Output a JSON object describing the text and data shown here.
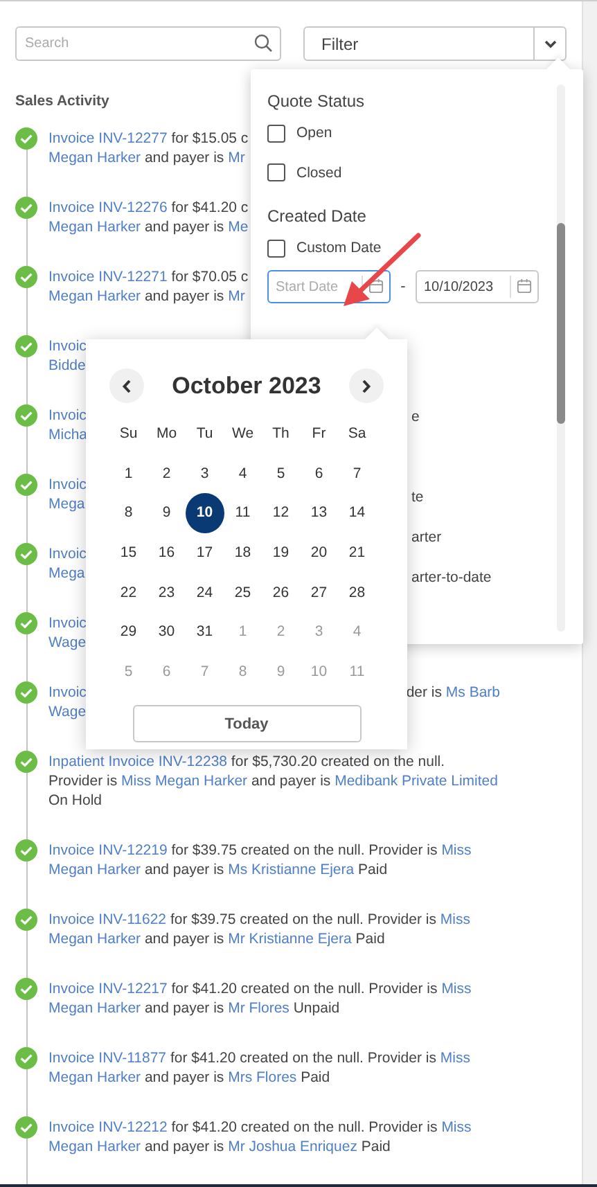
{
  "search": {
    "placeholder": "Search"
  },
  "filter": {
    "label": "Filter"
  },
  "sales_activity": {
    "title": "Sales Activity",
    "items": [
      {
        "lines": [
          [
            {
              "t": "Invoice INV-12277",
              "link": true
            },
            {
              "t": " for $15.05 c",
              "link": false
            }
          ],
          [
            {
              "t": "Megan Harker",
              "link": true
            },
            {
              "t": " and payer is ",
              "link": false
            },
            {
              "t": "Mr",
              "link": true
            }
          ]
        ]
      },
      {
        "lines": [
          [
            {
              "t": "Invoice INV-12276",
              "link": true
            },
            {
              "t": " for $41.20 c",
              "link": false
            }
          ],
          [
            {
              "t": "Megan Harker",
              "link": true
            },
            {
              "t": " and payer is ",
              "link": false
            },
            {
              "t": "Me",
              "link": true
            }
          ]
        ]
      },
      {
        "lines": [
          [
            {
              "t": "Invoice INV-12271",
              "link": true
            },
            {
              "t": " for $70.05 c",
              "link": false
            }
          ],
          [
            {
              "t": "Megan Harker",
              "link": true
            },
            {
              "t": " and payer is ",
              "link": false
            },
            {
              "t": "Mr",
              "link": true
            }
          ]
        ]
      },
      {
        "lines": [
          [
            {
              "t": "Invoic",
              "link": true
            }
          ],
          [
            {
              "t": "Bidde",
              "link": true
            }
          ]
        ]
      },
      {
        "lines": [
          [
            {
              "t": "Invoic",
              "link": true
            }
          ],
          [
            {
              "t": "Micha",
              "link": true
            }
          ]
        ]
      },
      {
        "lines": [
          [
            {
              "t": "Invoic",
              "link": true
            }
          ],
          [
            {
              "t": "Mega",
              "link": true
            }
          ]
        ]
      },
      {
        "lines": [
          [
            {
              "t": "Invoic",
              "link": true
            }
          ],
          [
            {
              "t": "Mega",
              "link": true
            }
          ]
        ]
      },
      {
        "lines": [
          [
            {
              "t": "Invoic",
              "link": true
            }
          ],
          [
            {
              "t": "Wage",
              "link": true
            }
          ]
        ]
      },
      {
        "lines": [
          [
            {
              "t": "Invoic",
              "link": true
            }
          ],
          [
            {
              "t": "Wage",
              "link": true
            }
          ]
        ],
        "aside": [
          {
            "t": "der is ",
            "link": false
          },
          {
            "t": "Ms Barb",
            "link": true
          }
        ]
      },
      {
        "lines": [
          [
            {
              "t": "Inpatient Invoice INV-12238",
              "link": true
            },
            {
              "t": " for $5,730.20 created on the null.",
              "link": false
            }
          ],
          [
            {
              "t": "Provider is ",
              "link": false
            },
            {
              "t": "Miss Megan Harker",
              "link": true
            },
            {
              "t": " and payer is ",
              "link": false
            },
            {
              "t": "Medibank Private Limited",
              "link": true
            }
          ],
          [
            {
              "t": "On Hold",
              "link": false
            }
          ]
        ]
      },
      {
        "lines": [
          [
            {
              "t": "Invoice INV-12219",
              "link": true
            },
            {
              "t": " for $39.75 created on the null. Provider is ",
              "link": false
            },
            {
              "t": "Miss",
              "link": true
            }
          ],
          [
            {
              "t": "Megan Harker",
              "link": true
            },
            {
              "t": " and payer is ",
              "link": false
            },
            {
              "t": "Ms Kristianne Ejera",
              "link": true
            },
            {
              "t": " Paid",
              "link": false
            }
          ]
        ]
      },
      {
        "lines": [
          [
            {
              "t": "Invoice INV-11622",
              "link": true
            },
            {
              "t": " for $39.75 created on the null. Provider is ",
              "link": false
            },
            {
              "t": "Miss",
              "link": true
            }
          ],
          [
            {
              "t": "Megan Harker",
              "link": true
            },
            {
              "t": " and payer is ",
              "link": false
            },
            {
              "t": "Mr Kristianne Ejera",
              "link": true
            },
            {
              "t": " Paid",
              "link": false
            }
          ]
        ]
      },
      {
        "lines": [
          [
            {
              "t": "Invoice INV-12217",
              "link": true
            },
            {
              "t": " for $41.20 created on the null. Provider is ",
              "link": false
            },
            {
              "t": "Miss",
              "link": true
            }
          ],
          [
            {
              "t": "Megan Harker",
              "link": true
            },
            {
              "t": " and payer is ",
              "link": false
            },
            {
              "t": "Mr Flores",
              "link": true
            },
            {
              "t": " Unpaid",
              "link": false
            }
          ]
        ]
      },
      {
        "lines": [
          [
            {
              "t": "Invoice INV-11877",
              "link": true
            },
            {
              "t": " for $41.20 created on the null. Provider is ",
              "link": false
            },
            {
              "t": "Miss",
              "link": true
            }
          ],
          [
            {
              "t": "Megan Harker",
              "link": true
            },
            {
              "t": " and payer is ",
              "link": false
            },
            {
              "t": "Mrs Flores",
              "link": true
            },
            {
              "t": " Paid",
              "link": false
            }
          ]
        ]
      },
      {
        "lines": [
          [
            {
              "t": "Invoice INV-12212",
              "link": true
            },
            {
              "t": " for $41.20 created on the null. Provider is ",
              "link": false
            },
            {
              "t": "Miss",
              "link": true
            }
          ],
          [
            {
              "t": "Megan Harker",
              "link": true
            },
            {
              "t": " and payer is ",
              "link": false
            },
            {
              "t": "Mr Joshua Enriquez",
              "link": true
            },
            {
              "t": " Paid",
              "link": false
            }
          ]
        ]
      }
    ]
  },
  "filter_panel": {
    "sections": [
      {
        "title": "Quote Status",
        "options": [
          {
            "label": "Open",
            "checked": false
          },
          {
            "label": "Closed",
            "checked": false
          }
        ]
      },
      {
        "title": "Created Date",
        "options": [
          {
            "label": "Custom Date",
            "checked": false
          }
        ]
      }
    ],
    "start_date": {
      "placeholder": "Start Date",
      "focused": true
    },
    "separator": "-",
    "end_date": {
      "value": "10/10/2023",
      "focused": false
    },
    "covered_options": [
      "e",
      "te",
      "arter",
      "arter-to-date"
    ]
  },
  "calendar": {
    "month": "October 2023",
    "weekdays": [
      "Su",
      "Mo",
      "Tu",
      "We",
      "Th",
      "Fr",
      "Sa"
    ],
    "weeks": [
      [
        {
          "d": "1",
          "muted": false,
          "selected": false
        },
        {
          "d": "2",
          "muted": false,
          "selected": false
        },
        {
          "d": "3",
          "muted": false,
          "selected": false
        },
        {
          "d": "4",
          "muted": false,
          "selected": false
        },
        {
          "d": "5",
          "muted": false,
          "selected": false
        },
        {
          "d": "6",
          "muted": false,
          "selected": false
        },
        {
          "d": "7",
          "muted": false,
          "selected": false
        }
      ],
      [
        {
          "d": "8",
          "muted": false,
          "selected": false
        },
        {
          "d": "9",
          "muted": false,
          "selected": false
        },
        {
          "d": "10",
          "muted": false,
          "selected": true
        },
        {
          "d": "11",
          "muted": false,
          "selected": false
        },
        {
          "d": "12",
          "muted": false,
          "selected": false
        },
        {
          "d": "13",
          "muted": false,
          "selected": false
        },
        {
          "d": "14",
          "muted": false,
          "selected": false
        }
      ],
      [
        {
          "d": "15",
          "muted": false,
          "selected": false
        },
        {
          "d": "16",
          "muted": false,
          "selected": false
        },
        {
          "d": "17",
          "muted": false,
          "selected": false
        },
        {
          "d": "18",
          "muted": false,
          "selected": false
        },
        {
          "d": "19",
          "muted": false,
          "selected": false
        },
        {
          "d": "20",
          "muted": false,
          "selected": false
        },
        {
          "d": "21",
          "muted": false,
          "selected": false
        }
      ],
      [
        {
          "d": "22",
          "muted": false,
          "selected": false
        },
        {
          "d": "23",
          "muted": false,
          "selected": false
        },
        {
          "d": "24",
          "muted": false,
          "selected": false
        },
        {
          "d": "25",
          "muted": false,
          "selected": false
        },
        {
          "d": "26",
          "muted": false,
          "selected": false
        },
        {
          "d": "27",
          "muted": false,
          "selected": false
        },
        {
          "d": "28",
          "muted": false,
          "selected": false
        }
      ],
      [
        {
          "d": "29",
          "muted": false,
          "selected": false
        },
        {
          "d": "30",
          "muted": false,
          "selected": false
        },
        {
          "d": "31",
          "muted": false,
          "selected": false
        },
        {
          "d": "1",
          "muted": true,
          "selected": false
        },
        {
          "d": "2",
          "muted": true,
          "selected": false
        },
        {
          "d": "3",
          "muted": true,
          "selected": false
        },
        {
          "d": "4",
          "muted": true,
          "selected": false
        }
      ],
      [
        {
          "d": "5",
          "muted": true,
          "selected": false
        },
        {
          "d": "6",
          "muted": true,
          "selected": false
        },
        {
          "d": "7",
          "muted": true,
          "selected": false
        },
        {
          "d": "8",
          "muted": true,
          "selected": false
        },
        {
          "d": "9",
          "muted": true,
          "selected": false
        },
        {
          "d": "10",
          "muted": true,
          "selected": false
        },
        {
          "d": "11",
          "muted": true,
          "selected": false
        }
      ]
    ],
    "today_button": "Today"
  }
}
